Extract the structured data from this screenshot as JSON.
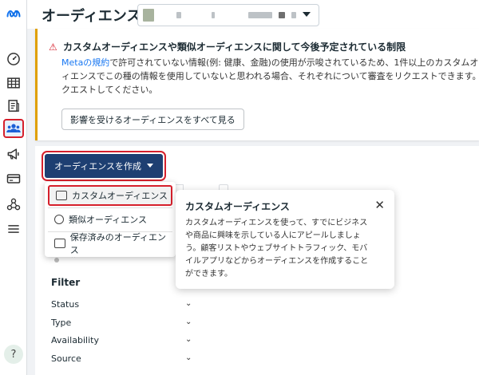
{
  "header": {
    "title": "オーディエンス"
  },
  "rail": {
    "icons": [
      "meta-logo-icon",
      "dashboard-icon",
      "table-icon",
      "catalog-icon",
      "audiences-icon",
      "campaign-icon",
      "billing-icon",
      "network-icon",
      "menu-icon"
    ],
    "help_label": "?"
  },
  "warning": {
    "title": "カスタムオーディエンスや類似オーディエンスに関して今後予定されている制限",
    "body_link": "Metaの規約",
    "body_line1_rest": "で許可されていない情報(例: 健康、金融)の使用が示唆されているため、1件以上のカスタムオーディ",
    "body_line2": "ィエンスでこの種の情報を使用していないと思われる場合、それぞれについて審査をリクエストできます。リク",
    "body_line3": "クエストしてください。",
    "button_label": "影響を受けるオーディエンスをすべて見る"
  },
  "create": {
    "button_label": "オーディエンスを作成"
  },
  "menu": {
    "items": [
      {
        "label": "カスタムオーディエンス"
      },
      {
        "label": "類似オーディエンス"
      },
      {
        "label": "保存済みのオーディエンス"
      }
    ]
  },
  "tooltip": {
    "title": "カスタムオーディエンス",
    "line1": "カスタムオーディエンスを使って、すでにビジネス",
    "line2": "や商品に興味を示している人にアピールしましょ",
    "line3": "う。顧客リストやウェブサイトトラフィック、モバ",
    "line4": "イルアプリなどからオーディエンスを作成すること",
    "line5": "ができます。"
  },
  "filter": {
    "title": "Filter",
    "rows": [
      "Status",
      "Type",
      "Availability",
      "Source"
    ]
  },
  "colors": {
    "accent": "#1e3f72",
    "highlight": "#d6202c",
    "link": "#1877f2",
    "warning_bar": "#e0a000"
  }
}
